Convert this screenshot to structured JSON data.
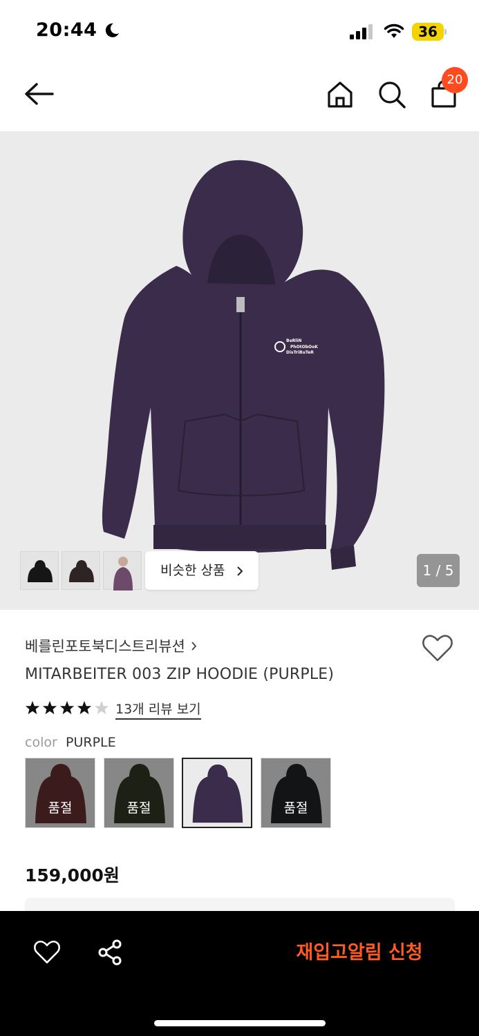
{
  "status_bar": {
    "time": "20:44",
    "battery": "36"
  },
  "nav": {
    "cart_count": "20"
  },
  "gallery": {
    "page_counter": "1 / 5",
    "similar_button": "비슷한 상품",
    "hoodie_print_lines": [
      "BeRliN",
      "PhOtObOoK",
      "DisTriBuTeR"
    ]
  },
  "product": {
    "brand": "베를린포토북디스트리뷰션",
    "title": "MITARBEITER 003 ZIP HOODIE (PURPLE)",
    "rating": 4,
    "rating_max": 5,
    "review_link": "13개 리뷰 보기",
    "color_label": "color",
    "color_value": "PURPLE",
    "color_options": [
      {
        "soldout_label": "품절"
      },
      {
        "soldout_label": "품절"
      },
      {
        "soldout_label": ""
      },
      {
        "soldout_label": "품절"
      }
    ],
    "price": "159,000원"
  },
  "bottom_bar": {
    "restock_label": "재입고알림 신청"
  },
  "colors": {
    "accent": "#ff5a1f",
    "badge": "#ff4b1f",
    "hoodie_purple": "#3a2c4a",
    "bottom_bar_bg": "#000000"
  }
}
